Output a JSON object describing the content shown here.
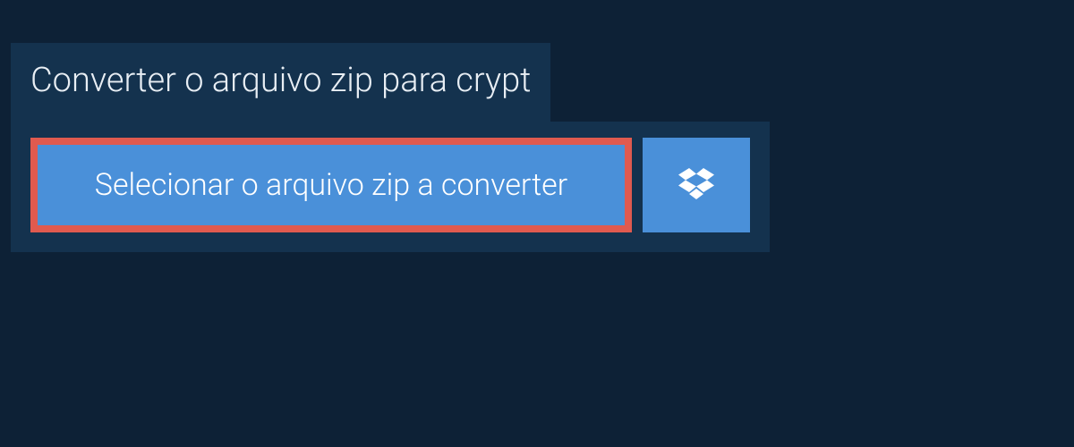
{
  "heading": "Converter o arquivo zip para crypt",
  "buttons": {
    "select_label": "Selecionar o arquivo zip a converter"
  },
  "icons": {
    "dropbox": "dropbox"
  },
  "colors": {
    "background": "#0d2136",
    "panel": "#14324e",
    "button": "#4a90d9",
    "highlight_border": "#e05a4f",
    "text_light": "#e8eef4",
    "text_white": "#ffffff"
  }
}
